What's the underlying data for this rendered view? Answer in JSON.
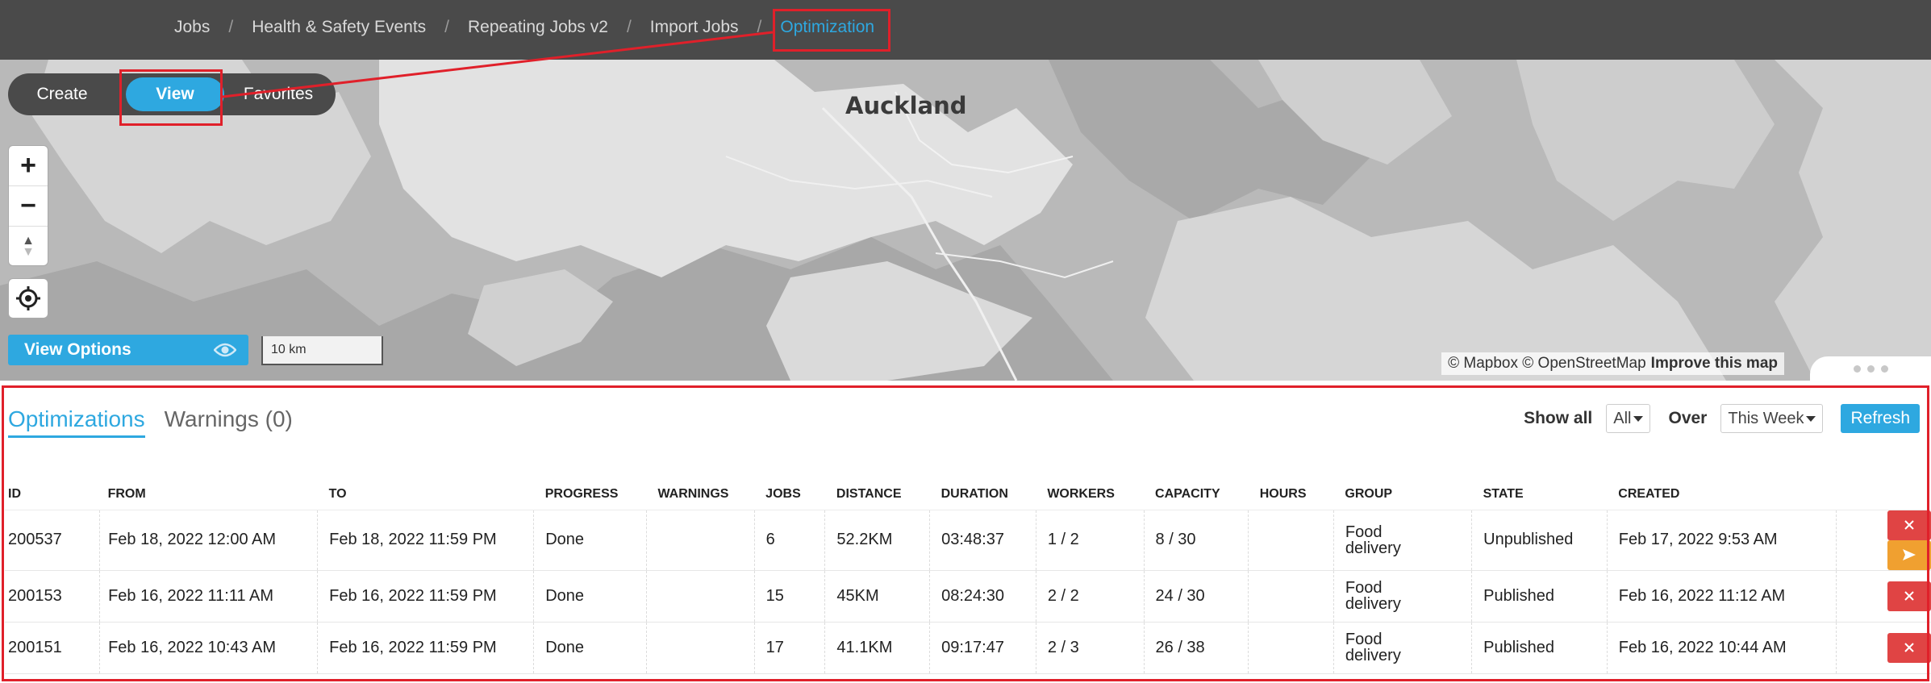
{
  "breadcrumb": {
    "items": [
      {
        "label": "Jobs"
      },
      {
        "label": "Health & Safety Events"
      },
      {
        "label": "Repeating Jobs v2"
      },
      {
        "label": "Import Jobs"
      },
      {
        "label": "Optimization"
      }
    ],
    "separator": "/"
  },
  "mode_switch": {
    "create": "Create",
    "view": "View",
    "favorites": "Favorites"
  },
  "map": {
    "place_label": "Auckland",
    "attribution": "© Mapbox © OpenStreetMap",
    "improve_link": "Improve this map",
    "zoom_in": "+",
    "zoom_out": "−",
    "compass": "▲",
    "view_options": "View Options",
    "scale": "10 km"
  },
  "panel": {
    "tabs": [
      {
        "label": "Optimizations"
      },
      {
        "label": "Warnings (0)"
      }
    ],
    "show_all_label": "Show all",
    "show_all_value": "All",
    "over_label": "Over",
    "over_value": "This Week",
    "refresh": "Refresh",
    "columns": [
      "ID",
      "FROM",
      "TO",
      "PROGRESS",
      "WARNINGS",
      "JOBS",
      "DISTANCE",
      "DURATION",
      "WORKERS",
      "CAPACITY",
      "HOURS",
      "GROUP",
      "STATE",
      "CREATED"
    ],
    "rows": [
      {
        "id": "200537",
        "from": "Feb 18, 2022 12:00 AM",
        "to": "Feb 18, 2022 11:59 PM",
        "progress": "Done",
        "warnings": "",
        "jobs": "6",
        "distance": "52.2KM",
        "duration": "03:48:37",
        "workers": "1 / 2",
        "capacity": "8 / 30",
        "hours": "",
        "group_1": "Food",
        "group_2": "delivery",
        "state": "Unpublished",
        "created": "Feb 17, 2022 9:53 AM"
      },
      {
        "id": "200153",
        "from": "Feb 16, 2022 11:11 AM",
        "to": "Feb 16, 2022 11:59 PM",
        "progress": "Done",
        "warnings": "",
        "jobs": "15",
        "distance": "45KM",
        "duration": "08:24:30",
        "workers": "2 / 2",
        "capacity": "24 / 30",
        "hours": "",
        "group_1": "Food",
        "group_2": "delivery",
        "state": "Published",
        "created": "Feb 16, 2022 11:12 AM"
      },
      {
        "id": "200151",
        "from": "Feb 16, 2022 10:43 AM",
        "to": "Feb 16, 2022 11:59 PM",
        "progress": "Done",
        "warnings": "",
        "jobs": "17",
        "distance": "41.1KM",
        "duration": "09:17:47",
        "workers": "2 / 3",
        "capacity": "26 / 38",
        "hours": "",
        "group_1": "Food",
        "group_2": "delivery",
        "state": "Published",
        "created": "Feb 16, 2022 10:44 AM"
      }
    ]
  },
  "icons": {
    "delete": "close-icon",
    "publish": "send-icon",
    "locate": "crosshair-icon",
    "visibility": "eye-icon"
  },
  "colors": {
    "accent": "#2ea8e0",
    "nav_bg": "#4a4a4a",
    "danger": "#e04444",
    "warning": "#f0a030",
    "highlight": "#e0202a"
  }
}
